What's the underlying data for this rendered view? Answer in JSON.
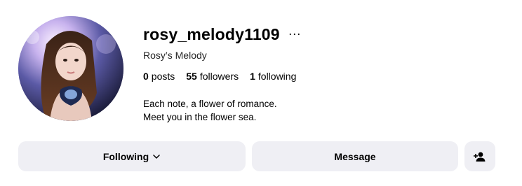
{
  "profile": {
    "username": "rosy_melody1109",
    "display_name": "Rosy’s Melody",
    "bio_lines": [
      "Each note, a flower of romance.",
      "Meet you in the flower sea."
    ],
    "more_icon": "ellipsis-icon"
  },
  "stats": {
    "posts": {
      "count": "0",
      "label": "posts"
    },
    "followers": {
      "count": "55",
      "label": "followers"
    },
    "following": {
      "count": "1",
      "label": "following"
    }
  },
  "actions": {
    "following_label": "Following",
    "message_label": "Message",
    "add_user_icon": "person-add-icon"
  },
  "colors": {
    "button_bg": "#efeff4",
    "text": "#000000"
  }
}
